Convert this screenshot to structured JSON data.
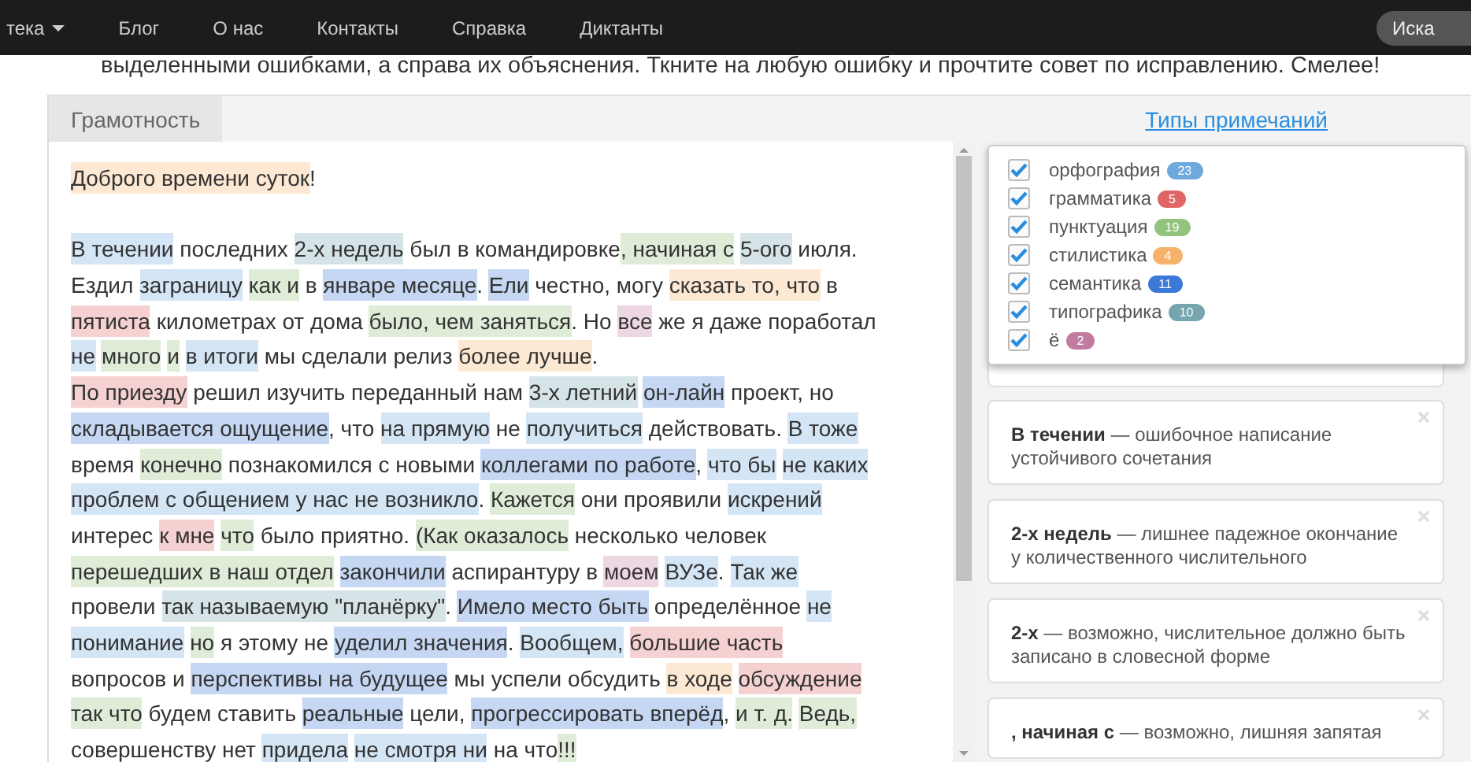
{
  "nav": {
    "items": [
      {
        "label": "тека",
        "dropdown": true
      },
      {
        "label": "Блог",
        "dropdown": false
      },
      {
        "label": "О нас",
        "dropdown": false
      },
      {
        "label": "Контакты",
        "dropdown": false
      },
      {
        "label": "Справка",
        "dropdown": false
      },
      {
        "label": "Диктанты",
        "dropdown": false
      }
    ],
    "search": {
      "value": "Иска"
    }
  },
  "intro": "выделенными ошибками, а справа их объяснения. Ткните на любую ошибку и прочтите совет по исправлению. Смелее!",
  "tabs": [
    {
      "label": "Грамотность",
      "selected": true
    }
  ],
  "types_link": "Типы примечаний",
  "categories": [
    {
      "kind": "orthography",
      "label": "орфография",
      "count": "23",
      "color": "#6fa8dc",
      "checked": true
    },
    {
      "kind": "grammar",
      "label": "грамматика",
      "count": "5",
      "color": "#e06666",
      "checked": true
    },
    {
      "kind": "punctuation",
      "label": "пунктуация",
      "count": "19",
      "color": "#93c47d",
      "checked": true
    },
    {
      "kind": "stylistics",
      "label": "стилистика",
      "count": "4",
      "color": "#f6b26b",
      "checked": true
    },
    {
      "kind": "semantics",
      "label": "семантика",
      "count": "11",
      "color": "#3c78d8",
      "checked": true
    },
    {
      "kind": "typography",
      "label": "типографика",
      "count": "10",
      "color": "#76a5af",
      "checked": true
    },
    {
      "kind": "yo",
      "label": "ё",
      "count": "2",
      "color": "#c27ba0",
      "checked": true
    }
  ],
  "greeting": [
    {
      "t": "Доброго времени суток",
      "kind": "stylistics"
    },
    {
      "t": "!"
    }
  ],
  "lines": [
    [
      {
        "t": "В течении",
        "kind": "orthography"
      },
      {
        "t": " последних "
      },
      {
        "t": "2-х недель",
        "kind": "typography"
      },
      {
        "t": " был в командировке"
      },
      {
        "t": ", начиная с",
        "kind": "punctuation",
        "space_after": true
      },
      {
        "t": "5-ого",
        "kind": "typography"
      },
      {
        "t": " июля."
      }
    ],
    [
      {
        "t": "Ездил "
      },
      {
        "t": "заграницу",
        "kind": "orthography",
        "space_after": true
      },
      {
        "t": "как и",
        "kind": "punctuation"
      },
      {
        "t": " в "
      },
      {
        "t": "январе месяце",
        "kind": "semantics"
      },
      {
        "t": ". "
      },
      {
        "t": "Ели",
        "kind": "semantics"
      },
      {
        "t": " честно, могу "
      },
      {
        "t": "сказать то, что",
        "kind": "stylistics"
      },
      {
        "t": " в"
      }
    ],
    [
      {
        "t": "пятиста",
        "kind": "grammar"
      },
      {
        "t": " километрах от дома "
      },
      {
        "t": "было, чем заняться",
        "kind": "punctuation"
      },
      {
        "t": ". Но "
      },
      {
        "t": "все",
        "kind": "yo"
      },
      {
        "t": " же я даже поработал"
      }
    ],
    [
      {
        "t": "не",
        "kind": "orthography",
        "space_after": true
      },
      {
        "t": "много",
        "kind": "punctuation",
        "space_after": true
      },
      {
        "t": "и",
        "kind": "punctuation",
        "space_after": true
      },
      {
        "t": "в итоги",
        "kind": "orthography"
      },
      {
        "t": " мы сделали релиз "
      },
      {
        "t": "более лучше",
        "kind": "stylistics"
      },
      {
        "t": "."
      }
    ],
    [
      {
        "t": "По приезду",
        "kind": "grammar"
      },
      {
        "t": " решил изучить переданный нам "
      },
      {
        "t": "3-х летний",
        "kind": "typography",
        "space_after": true
      },
      {
        "t": "он-лайн",
        "kind": "semantics"
      },
      {
        "t": " проект, но"
      }
    ],
    [
      {
        "t": "складывается ощущение",
        "kind": "semantics"
      },
      {
        "t": ", что "
      },
      {
        "t": "на прямую",
        "kind": "orthography"
      },
      {
        "t": " не "
      },
      {
        "t": "получиться",
        "kind": "orthography"
      },
      {
        "t": " действовать. "
      },
      {
        "t": "В тоже",
        "kind": "orthography"
      }
    ],
    [
      {
        "t": "время "
      },
      {
        "t": "конечно",
        "kind": "punctuation"
      },
      {
        "t": " познакомился с новыми "
      },
      {
        "t": "коллегами по работе",
        "kind": "semantics"
      },
      {
        "t": ", "
      },
      {
        "t": "что бы",
        "kind": "orthography",
        "space_after": true
      },
      {
        "t": "не каких",
        "kind": "orthography"
      }
    ],
    [
      {
        "t": "проблем с общением у нас не возникло",
        "kind": "orthography"
      },
      {
        "t": ". "
      },
      {
        "t": "Кажется",
        "kind": "punctuation"
      },
      {
        "t": " они проявили "
      },
      {
        "t": "искрений",
        "kind": "orthography"
      }
    ],
    [
      {
        "t": "интерес "
      },
      {
        "t": "к мне",
        "kind": "grammar",
        "space_after": true
      },
      {
        "t": "что",
        "kind": "punctuation"
      },
      {
        "t": " было приятно. "
      },
      {
        "t": "(Как оказалось",
        "kind": "punctuation"
      },
      {
        "t": " несколько человек"
      }
    ],
    [
      {
        "t": "перешедших в наш отдел",
        "kind": "punctuation",
        "space_after": true
      },
      {
        "t": "закончили",
        "kind": "semantics"
      },
      {
        "t": " аспирантуру в "
      },
      {
        "t": "моем",
        "kind": "yo",
        "space_after": true
      },
      {
        "t": "ВУЗе",
        "kind": "orthography"
      },
      {
        "t": ". "
      },
      {
        "t": "Так же",
        "kind": "orthography"
      }
    ],
    [
      {
        "t": "провели "
      },
      {
        "t": "так называемую \"планёрку\"",
        "kind": "typography"
      },
      {
        "t": ". "
      },
      {
        "t": "Имело место быть",
        "kind": "semantics"
      },
      {
        "t": " определённое "
      },
      {
        "t": "не",
        "kind": "orthography"
      }
    ],
    [
      {
        "t": "понимание",
        "kind": "orthography",
        "space_after": true
      },
      {
        "t": "но",
        "kind": "punctuation"
      },
      {
        "t": " я этому не "
      },
      {
        "t": "уделил значения",
        "kind": "semantics"
      },
      {
        "t": ". "
      },
      {
        "t": "Вообщем,",
        "kind": "orthography",
        "space_after": true
      },
      {
        "t": "большие часть",
        "kind": "grammar"
      }
    ],
    [
      {
        "t": "вопросов и "
      },
      {
        "t": "перспективы на будущее",
        "kind": "semantics"
      },
      {
        "t": " мы успели обсудить "
      },
      {
        "t": "в ходе",
        "kind": "stylistics",
        "space_after": true
      },
      {
        "t": "обсуждение",
        "kind": "grammar"
      }
    ],
    [
      {
        "t": "так что",
        "kind": "punctuation"
      },
      {
        "t": " будем ставить "
      },
      {
        "t": "реальные",
        "kind": "semantics"
      },
      {
        "t": " цели, "
      },
      {
        "t": "прогрессировать вперёд",
        "kind": "semantics"
      },
      {
        "t": ", "
      },
      {
        "t": "и т. д.",
        "kind": "punctuation",
        "space_after": true
      },
      {
        "t": "Ведь,",
        "kind": "punctuation"
      }
    ],
    [
      {
        "t": "совершенству нет "
      },
      {
        "t": "придела",
        "kind": "orthography",
        "space_after": true
      },
      {
        "t": "не смотря ни",
        "kind": "orthography"
      },
      {
        "t": " на что"
      },
      {
        "t": "!!!",
        "kind": "punctuation"
      }
    ]
  ],
  "notes": [
    "**В течении** — ошибочное написание устойчивого сочетания",
    "**2-х недель** — лишнее падежное окончание у количественного числительного",
    "**2-х** — возможно, числительное должно быть записано в словесной форме",
    "**, начиная с** — возможно, лишняя запятая"
  ]
}
